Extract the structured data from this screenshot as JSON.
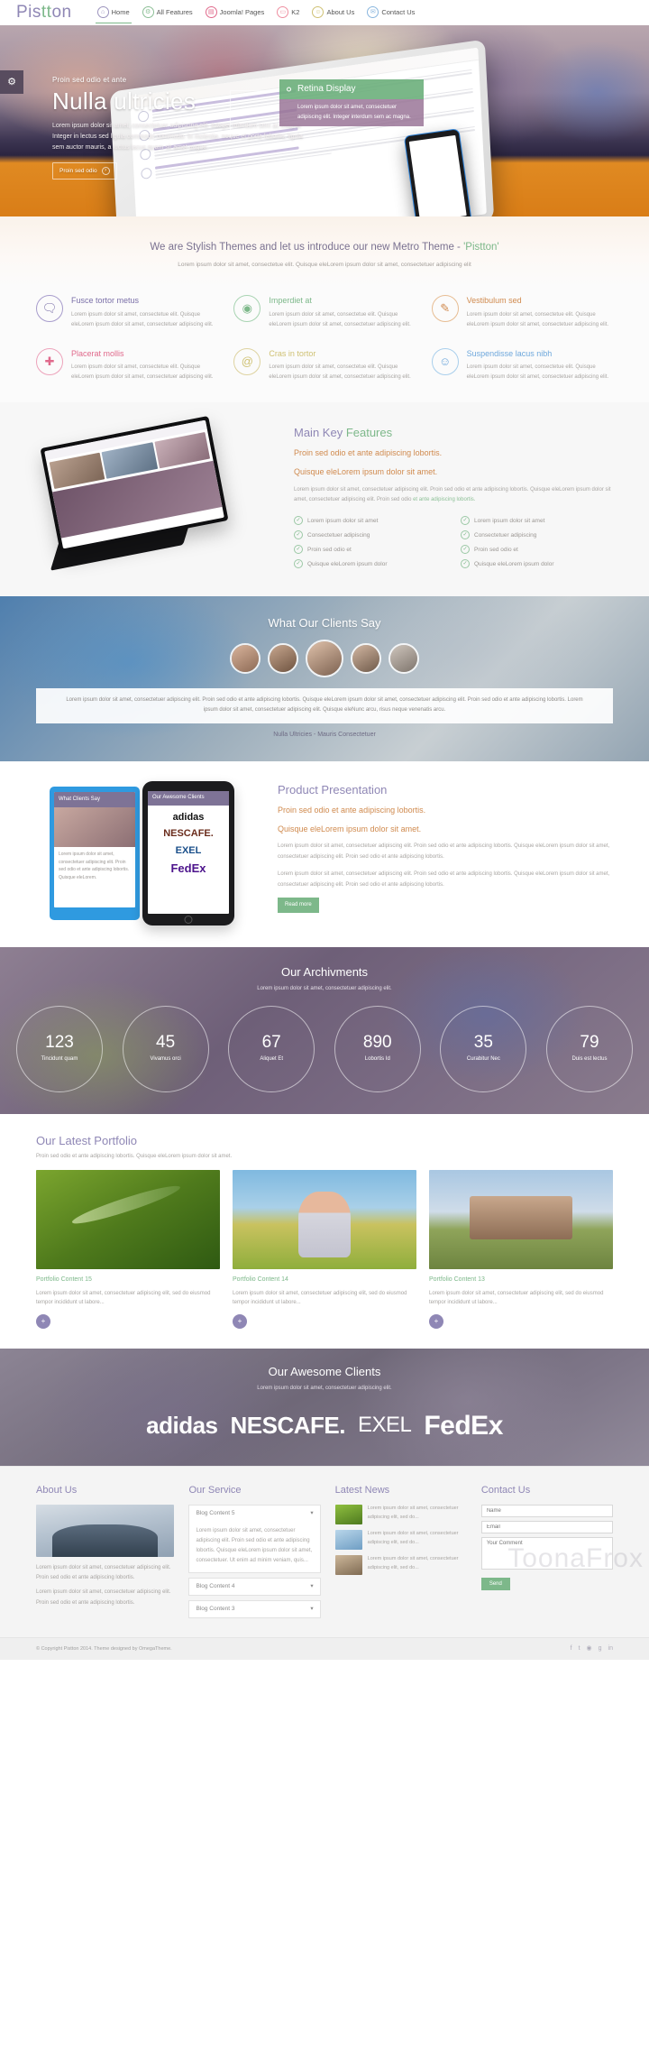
{
  "brand": {
    "part1": "Pis",
    "part2": "tt",
    "part3": "on"
  },
  "nav": {
    "items": [
      {
        "label": "Home",
        "icon": "home-icon",
        "glyph": "⌂",
        "color": "#9b93bd",
        "active": true
      },
      {
        "label": "All Features",
        "icon": "wrench-icon",
        "glyph": "⚒",
        "color": "#8cbf96",
        "active": false
      },
      {
        "label": "Joomla! Pages",
        "icon": "document-icon",
        "glyph": "▤",
        "color": "#e06a8c",
        "active": false
      },
      {
        "label": "K2",
        "icon": "comment-icon",
        "glyph": "▭",
        "color": "#ee8fa0",
        "active": false
      },
      {
        "label": "About Us",
        "icon": "user-icon",
        "glyph": "☺",
        "color": "#cfc173",
        "active": false
      },
      {
        "label": "Contact Us",
        "icon": "envelope-icon",
        "glyph": "✉",
        "color": "#8ab6de",
        "active": false
      }
    ]
  },
  "hero": {
    "settings_icon": "gear-icon",
    "subtitle": "Proin sed odio et ante",
    "title": "Nulla ultricies",
    "paragraph": "Lorem ipsum dolor sit amet, consectetuer adipiscing elit. Integer interdum sem ac magna. Integer in lectus sed ligula commodo commodo. In molestie, neque et porta lobortis, ligula sem auctor mauris, a luctus lacus quam sit amet augue.",
    "button": "Proin sed odio",
    "tooltip_title": "Retina Display",
    "tooltip_body": "Lorem ipsum dolor sit amet, consectetuer adipiscing elit. Integer interdum sem ac magna."
  },
  "intro": {
    "heading_a": "We are Stylish Themes and let us introduce our new Metro Theme - ",
    "heading_b": "'Pistton'",
    "sub": "Lorem ipsum dolor sit amet, consectetue elit. Quisque eleLorem ipsum dolor sit amet, consectetuer adipiscing elit"
  },
  "features": {
    "body": "Lorem ipsum dolor sit amet, consectetue elit. Quisque eleLorem ipsum dolor sit amet, consectetuer adipiscing elit.",
    "items": [
      {
        "title": "Fusce tortor metus",
        "icon": "speech-bubble-icon",
        "glyph": "⌨",
        "color": "#7a6fa8"
      },
      {
        "title": "Imperdiet at",
        "icon": "map-pin-icon",
        "glyph": "◎",
        "color": "#7db88a"
      },
      {
        "title": "Vestibulum sed",
        "icon": "pencil-edit-icon",
        "glyph": "✎",
        "color": "#d08a4e"
      },
      {
        "title": "Placerat mollis",
        "icon": "shield-plus-icon",
        "glyph": "⊕",
        "color": "#e06a8c"
      },
      {
        "title": "Cras in tortor",
        "icon": "at-sign-icon",
        "glyph": "@",
        "color": "#cfc173"
      },
      {
        "title": "Suspendisse lacus nibh",
        "icon": "users-icon",
        "glyph": "⚯",
        "color": "#6fa8dc"
      }
    ]
  },
  "mainkey": {
    "title_a": "Main Key ",
    "title_b": "Features",
    "lead1": "Proin sed odio et ante adipiscing lobortis.",
    "lead2": "Quisque eleLorem ipsum dolor sit amet.",
    "para_a": "Lorem ipsum dolor sit amet, consectetuer adipiscing elit. Proin sed odio et ante adipiscing lobortis. Quisque eleLorem ipsum dolor sit amet, consectetuer adipiscing elit. Proin sed odio ",
    "para_b": "et ante adipiscing lobortis.",
    "list_left": [
      "Lorem ipsum dolor sit amet",
      "Consectetuer adipiscing",
      "Proin sed odio et",
      "Quisque eleLorem ipsum dolor"
    ],
    "list_right": [
      "Lorem ipsum dolor sit amet",
      "Consectetuer adipiscing",
      "Proin sed odio et",
      "Quisque eleLorem ipsum dolor"
    ]
  },
  "testimonials": {
    "heading": "What Our Clients Say",
    "quote": "Lorem ipsum dolor sit amet, consectetuer adipiscing elit. Proin sed odio et ante adipiscing lobortis. Quisque eleLorem ipsum dolor sit amet, consectetuer adipiscing elit. Proin sed odio et ante adipiscing lobortis. Lorem ipsum dolor sit amet, consectetuer adipiscing elit. Quisque eleNunc arcu, risus neque venenatis arcu.",
    "author": "Nulla Ultricies - Mauris Consectetuer",
    "avatars": [
      "avatar-1",
      "avatar-2",
      "avatar-3",
      "avatar-4",
      "avatar-5"
    ]
  },
  "product": {
    "title": "Product Presentation",
    "lead1": "Proin sed odio et ante adipiscing lobortis.",
    "lead2": "Quisque eleLorem ipsum dolor sit amet.",
    "para1": "Lorem ipsum dolor sit amet, consectetuer adipiscing elit. Proin sed odio et ante adipiscing lobortis. Quisque eleLorem ipsum dolor sit amet, consectetuer adipiscing elit. Proin sed odio et ante adipiscing lobortis.",
    "para2": "Lorem ipsum dolor sit amet, consectetuer adipiscing elit. Proin sed odio et ante adipiscing lobortis. Quisque eleLorem ipsum dolor sit amet, consectetuer adipiscing elit. Proin sed odio et ante adipiscing lobortis.",
    "button": "Read more",
    "phone1_title": "What Clients Say",
    "phone1_text": "Lorem ipsum dolor sit amet, consectetuer adipiscing elit. Proin sed odio et ante adipiscing lobortis. Quisque eleLorem.",
    "phone2_title": "Our Awesome Clients",
    "phone2_brands": [
      "adidas",
      "NESCAFE.",
      "EXEL",
      "FedEx"
    ]
  },
  "achievements": {
    "heading": "Our Archivments",
    "sub": "Lorem ipsum dolor sit amet, consectetuer adipiscing elit.",
    "stats": [
      {
        "number": "123",
        "label": "Tincidunt quam"
      },
      {
        "number": "45",
        "label": "Vivamus orci"
      },
      {
        "number": "67",
        "label": "Aliquet Et"
      },
      {
        "number": "890",
        "label": "Lobortis Id"
      },
      {
        "number": "35",
        "label": "Curabitur Nec"
      },
      {
        "number": "79",
        "label": "Duis est lectus"
      }
    ]
  },
  "portfolio": {
    "heading": "Our Latest Portfolio",
    "sub": "Proin sed odio et ante adipiscing lobortis. Quisque eleLorem ipsum dolor sit amet.",
    "items": [
      {
        "title": "Portfolio Content 15",
        "text": "Lorem ipsum dolor sit amet, consectetuer adipiscing elit, sed do eiusmod tempor incididunt ut labore...",
        "more": "+"
      },
      {
        "title": "Portfolio Content 14",
        "text": "Lorem ipsum dolor sit amet, consectetuer adipiscing elit, sed do eiusmod tempor incididunt ut labore...",
        "more": "+"
      },
      {
        "title": "Portfolio Content 13",
        "text": "Lorem ipsum dolor sit amet, consectetuer adipiscing elit, sed do eiusmod tempor incididunt ut labore...",
        "more": "+"
      }
    ]
  },
  "clients": {
    "heading": "Our Awesome Clients",
    "sub": "Lorem ipsum dolor sit amet, consectetuer adipiscing elit.",
    "brands": [
      "adidas",
      "NESCAFE.",
      "EXEL",
      "FedEx"
    ]
  },
  "footer": {
    "about": {
      "title": "About Us",
      "image": "handshake-photo",
      "text1": "Lorem ipsum dolor sit amet, consectetuer adipiscing elit. Proin sed odio et ante adipiscing lobortis.",
      "text2": "Lorem ipsum dolor sit amet, consectetuer adipiscing elit. Proin sed odio et ante adipiscing lobortis."
    },
    "service": {
      "title": "Our Service",
      "items": [
        {
          "label": "Blog Content 5",
          "open": true,
          "body": "Lorem ipsum dolor sit amet, consectetuer adipiscing elit. Proin sed odio et ante adipiscing lobortis. Quisque eleLorem ipsum dolor sit amet, consectetuer. Ut enim ad minim veniam, quis..."
        },
        {
          "label": "Blog Content 4",
          "open": false,
          "body": ""
        },
        {
          "label": "Blog Content 3",
          "open": false,
          "body": ""
        }
      ],
      "chevron": "chevron-down-icon"
    },
    "news": {
      "title": "Latest News",
      "items": [
        {
          "text": "Lorem ipsum dolor sit amet, consectetuer adipiscing elit, sed do..."
        },
        {
          "text": "Lorem ipsum dolor sit amet, consectetuer adipiscing elit, sed do..."
        },
        {
          "text": "Lorem ipsum dolor sit amet, consectetuer adipiscing elit, sed do..."
        }
      ]
    },
    "contact": {
      "title": "Contact Us",
      "name_placeholder": "Name",
      "email_placeholder": "Email",
      "comment_placeholder": "Your Comment",
      "send_label": "Send"
    }
  },
  "copyright": {
    "text": "© Copyright Pistton 2014. Theme designed by OmegaTheme.",
    "social": [
      "facebook-icon",
      "twitter-icon",
      "rss-icon",
      "google-plus-icon",
      "linkedin-icon"
    ],
    "glyphs": [
      "f",
      "t",
      "◉",
      "g",
      "in"
    ]
  },
  "watermark": "ToonaFrox"
}
